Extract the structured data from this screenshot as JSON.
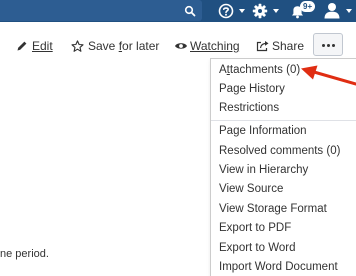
{
  "header": {
    "icons": [
      "search-icon",
      "help-icon",
      "gear-icon",
      "bell-icon",
      "user-icon"
    ],
    "notification_badge": "9+",
    "colors": {
      "bar": "#205081",
      "search_box": "#2d5d92"
    }
  },
  "toolbar": {
    "edit_label": "Edit",
    "save_for_later_label": "Save for later",
    "watching_label": "Watching",
    "share_label": "Share",
    "more_label": "•••"
  },
  "menu": {
    "group_one": [
      "Attachments (0)",
      "Page History",
      "Restrictions"
    ],
    "group_two": [
      "Page Information",
      "Resolved comments (0)",
      "View in Hierarchy",
      "View Source",
      "View Storage Format",
      "Export to PDF",
      "Export to Word",
      "Import Word Document"
    ]
  },
  "annotation": {
    "arrow_color": "#e02d12",
    "points_to": "Attachments (0)"
  },
  "content": {
    "text_fragment": "ne period."
  }
}
